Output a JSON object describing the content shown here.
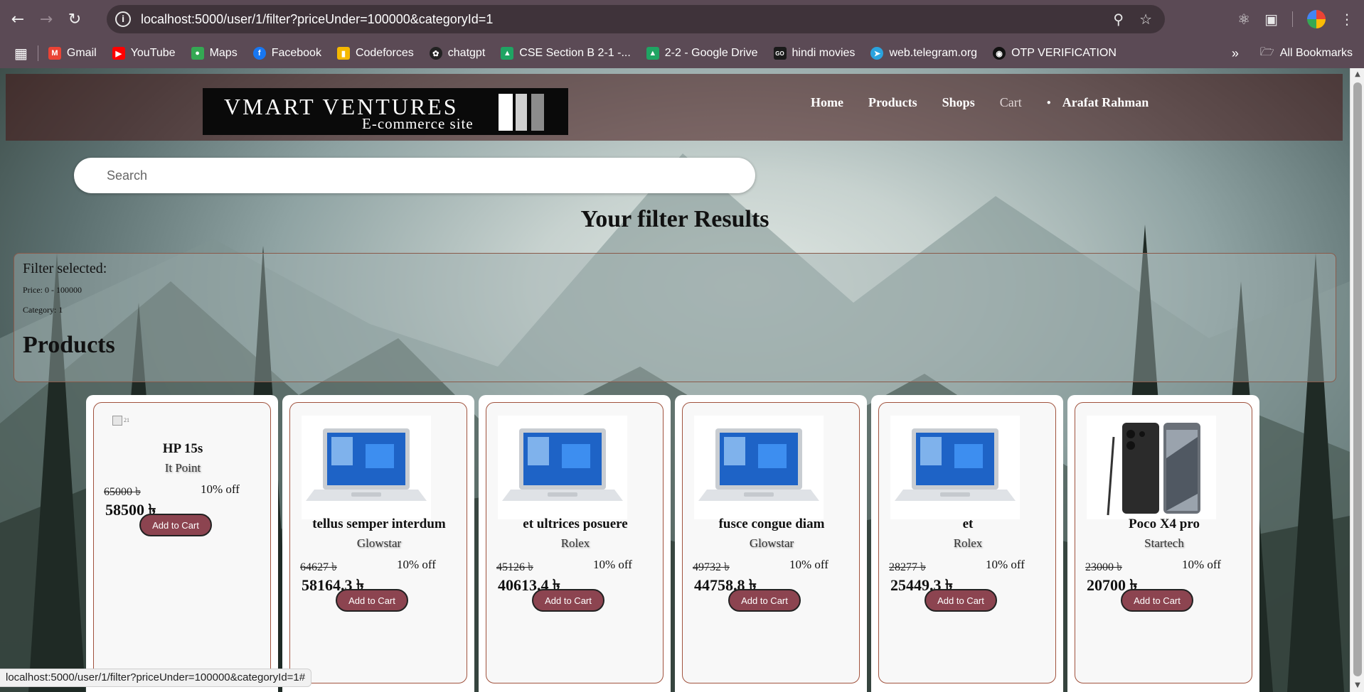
{
  "browser": {
    "url": "localhost:5000/user/1/filter?priceUnder=100000&categoryId=1",
    "bookmarks": [
      {
        "label": "Gmail",
        "icon": "gmail-icon",
        "color": "#ea4335"
      },
      {
        "label": "YouTube",
        "icon": "youtube-icon",
        "color": "#ff0000"
      },
      {
        "label": "Maps",
        "icon": "maps-icon",
        "color": "#34a853"
      },
      {
        "label": "Facebook",
        "icon": "facebook-icon",
        "color": "#1877f2"
      },
      {
        "label": "Codeforces",
        "icon": "codeforces-icon",
        "color": "#f5b800"
      },
      {
        "label": "chatgpt",
        "icon": "chatgpt-icon",
        "color": "#222222"
      },
      {
        "label": "CSE Section B 2-1 -...",
        "icon": "drive-icon",
        "color": "#1fa463"
      },
      {
        "label": "2-2 - Google Drive",
        "icon": "drive-icon",
        "color": "#1fa463"
      },
      {
        "label": "hindi movies",
        "icon": "movies-icon",
        "color": "#1a1a1a"
      },
      {
        "label": "web.telegram.org",
        "icon": "telegram-icon",
        "color": "#2aa3de"
      },
      {
        "label": "OTP VERIFICATION",
        "icon": "github-icon",
        "color": "#111111"
      }
    ],
    "all_bookmarks": "All Bookmarks",
    "status_url": "localhost:5000/user/1/filter?priceUnder=100000&categoryId=1#"
  },
  "site": {
    "brand": "VMART VENTURES",
    "tagline": "E-commerce site",
    "nav": {
      "home": "Home",
      "products": "Products",
      "shops": "Shops",
      "cart": "Cart",
      "user": "Arafat Rahman"
    },
    "search_placeholder": "Search",
    "results_title": "Your filter Results",
    "filter": {
      "heading": "Filter selected:",
      "price": "Price: 0 - 100000",
      "category": "Category: 1",
      "products_heading": "Products"
    },
    "add_to_cart": "Add to Cart",
    "products": [
      {
        "name": "HP 15s",
        "shop": "It Point",
        "old_price": "65000 ৳",
        "discount": "10% off",
        "price": "58500 ৳",
        "image": "broken",
        "alt": "21"
      },
      {
        "name": "tellus semper interdum",
        "shop": "Glowstar",
        "old_price": "64627 ৳",
        "discount": "10% off",
        "price": "58164.3 ৳",
        "image": "laptop"
      },
      {
        "name": "et ultrices posuere",
        "shop": "Rolex",
        "old_price": "45126 ৳",
        "discount": "10% off",
        "price": "40613.4 ৳",
        "image": "laptop"
      },
      {
        "name": "fusce congue diam",
        "shop": "Glowstar",
        "old_price": "49732 ৳",
        "discount": "10% off",
        "price": "44758.8 ৳",
        "image": "laptop"
      },
      {
        "name": "et",
        "shop": "Rolex",
        "old_price": "28277 ৳",
        "discount": "10% off",
        "price": "25449.3 ৳",
        "image": "laptop"
      },
      {
        "name": "Poco X4 pro",
        "shop": "Startech",
        "old_price": "23000 ৳",
        "discount": "10% off",
        "price": "20700 ৳",
        "image": "phone"
      }
    ]
  }
}
